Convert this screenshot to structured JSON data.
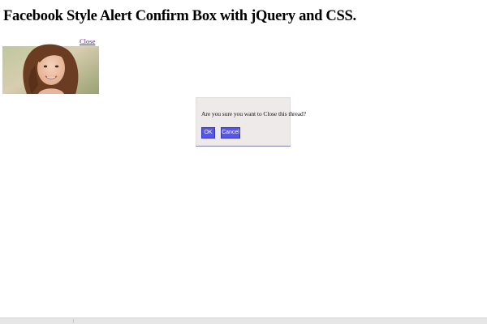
{
  "page": {
    "title": "Facebook Style Alert Confirm Box with jQuery and CSS."
  },
  "photo_card": {
    "close_label": "Close"
  },
  "confirm": {
    "message": "Are you sure you want to Close this thread?",
    "ok_label": "OK",
    "cancel_label": "Cancel"
  },
  "colors": {
    "button_bg": "#5555f0",
    "dialog_bg": "#efeaea",
    "link": "#551a8b"
  }
}
